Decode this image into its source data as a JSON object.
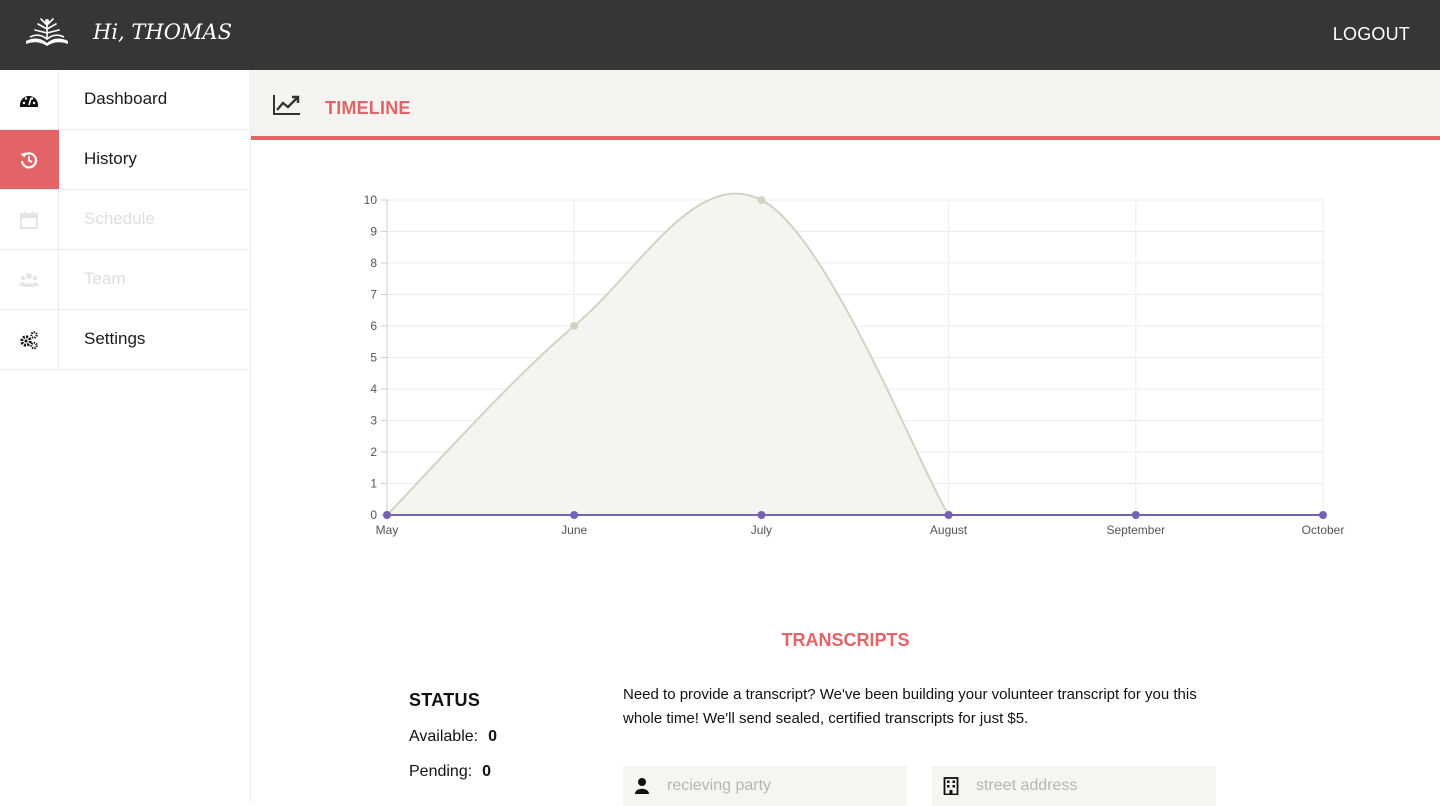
{
  "header": {
    "greeting": "Hi, THOMAS",
    "logout_label": "LOGOUT"
  },
  "sidebar": {
    "items": [
      {
        "label": "Dashboard",
        "icon": "dashboard-icon",
        "state": "normal"
      },
      {
        "label": "History",
        "icon": "history-icon",
        "state": "active"
      },
      {
        "label": "Schedule",
        "icon": "calendar-icon",
        "state": "disabled"
      },
      {
        "label": "Team",
        "icon": "team-icon",
        "state": "disabled"
      },
      {
        "label": "Settings",
        "icon": "gears-icon",
        "state": "normal"
      }
    ]
  },
  "timeline": {
    "title": "TIMELINE",
    "icon": "line-chart-icon"
  },
  "chart_data": {
    "type": "line",
    "x": [
      "May",
      "June",
      "July",
      "August",
      "September",
      "October"
    ],
    "series": [
      {
        "values": [
          0,
          6,
          10,
          0,
          null,
          null
        ],
        "color": "#d3d3c3",
        "fill": "#f4f4f0",
        "style": "smooth-area"
      },
      {
        "values": [
          0,
          0,
          0,
          0,
          0,
          0
        ],
        "color": "#7462b5"
      }
    ],
    "yticks": [
      "0",
      "1",
      "2",
      "3",
      "4",
      "5",
      "6",
      "7",
      "8",
      "9",
      "10"
    ],
    "ylim": [
      0,
      10
    ],
    "grid": true
  },
  "transcripts": {
    "title": "TRANSCRIPTS",
    "status_title": "STATUS",
    "available_label": "Available:",
    "available_value": "0",
    "pending_label": "Pending:",
    "pending_value": "0",
    "info_text": "Need to provide a transcript? We've been building your volunteer transcript for you this whole time! We'll send sealed, certified transcripts for just $5.",
    "receiving_party_placeholder": "recieving party",
    "street_address_placeholder": "street address"
  },
  "colors": {
    "accent": "#e36466",
    "topbar": "#363636",
    "panel": "#f6f4f1"
  }
}
